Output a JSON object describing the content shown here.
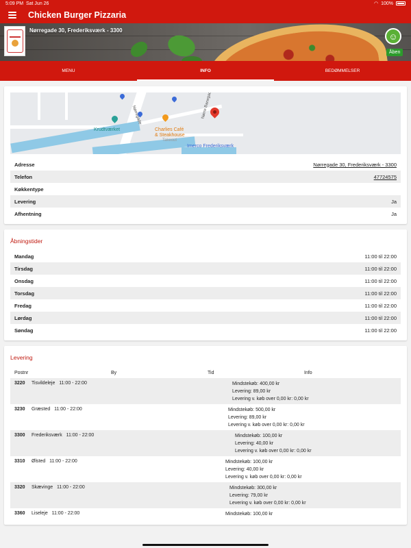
{
  "status_bar": {
    "time": "5:09 PM",
    "date": "Sat Jun 26",
    "battery": "100%"
  },
  "app_bar": {
    "title": "Chicken Burger Pizzaria"
  },
  "hero": {
    "address": "Nørregade 30, Frederiksværk - 3300",
    "open_label": "Åben"
  },
  "tabs": [
    {
      "label": "MENU",
      "active": false
    },
    {
      "label": "INFO",
      "active": true
    },
    {
      "label": "BEDØMMELSER",
      "active": false
    }
  ],
  "map": {
    "labels": {
      "krudtvaerket": "Krudtværket",
      "charlies": "Charlies Café",
      "steakhouse": "& Steakhouse",
      "takeout": "Takeout",
      "imerco": "Imerco Frederiksværk",
      "norregade": "Nørregade",
      "norrebanegade": "Nørre Banegade"
    }
  },
  "info": {
    "rows": [
      {
        "label": "Adresse",
        "value": "Nørregade 30, Frederiksværk - 3300"
      },
      {
        "label": "Telefon",
        "value": "47724575"
      },
      {
        "label": "Køkkentype",
        "value": ""
      },
      {
        "label": "Levering",
        "value": "Ja"
      },
      {
        "label": "Afhentning",
        "value": "Ja"
      }
    ]
  },
  "hours": {
    "title": "Åbningstider",
    "days": [
      {
        "day": "Mandag",
        "time": "11:00 til 22:00"
      },
      {
        "day": "Tirsdag",
        "time": "11:00 til 22:00"
      },
      {
        "day": "Onsdag",
        "time": "11:00 til 22:00"
      },
      {
        "day": "Torsdag",
        "time": "11:00 til 22:00"
      },
      {
        "day": "Fredag",
        "time": "11:00 til 22:00"
      },
      {
        "day": "Lørdag",
        "time": "11:00 til 22:00"
      },
      {
        "day": "Søndag",
        "time": "11:00 til 22:00"
      }
    ]
  },
  "delivery": {
    "title": "Levering",
    "headers": {
      "zip": "Postnr",
      "city": "By",
      "time": "Tid",
      "info": "Info"
    },
    "rows": [
      {
        "zip": "3220",
        "city": "Tisvildeleje",
        "time": "11:00 - 22:00",
        "min": "Mindstekøb: 400,00 kr",
        "fee": "Levering: 89,00 kr",
        "free": "Levering v. køb over 0,00 kr: 0,00 kr"
      },
      {
        "zip": "3230",
        "city": "Græsted",
        "time": "11:00 - 22:00",
        "min": "Mindstekøb: 500,00 kr",
        "fee": "Levering: 89,00 kr",
        "free": "Levering v. køb over 0,00 kr: 0,00 kr"
      },
      {
        "zip": "3300",
        "city": "Frederiksværk",
        "time": "11:00 - 22:00",
        "min": "Mindstekøb: 100,00 kr",
        "fee": "Levering: 40,00 kr",
        "free": "Levering v. køb over 0,00 kr: 0,00 kr"
      },
      {
        "zip": "3310",
        "city": "Ølsted",
        "time": "11:00 - 22:00",
        "min": "Mindstekøb: 100,00 kr",
        "fee": "Levering: 40,00 kr",
        "free": "Levering v. køb over 0,00 kr: 0,00 kr"
      },
      {
        "zip": "3320",
        "city": "Skævinge",
        "time": "11:00 - 22:00",
        "min": "Mindstekøb: 300,00 kr",
        "fee": "Levering: 79,00 kr",
        "free": "Levering v. køb over 0,00 kr: 0,00 kr"
      },
      {
        "zip": "3360",
        "city": "Liseleje",
        "time": "11:00 - 22:00",
        "min": "Mindstekøb: 100,00 kr",
        "fee": "",
        "free": ""
      }
    ]
  }
}
